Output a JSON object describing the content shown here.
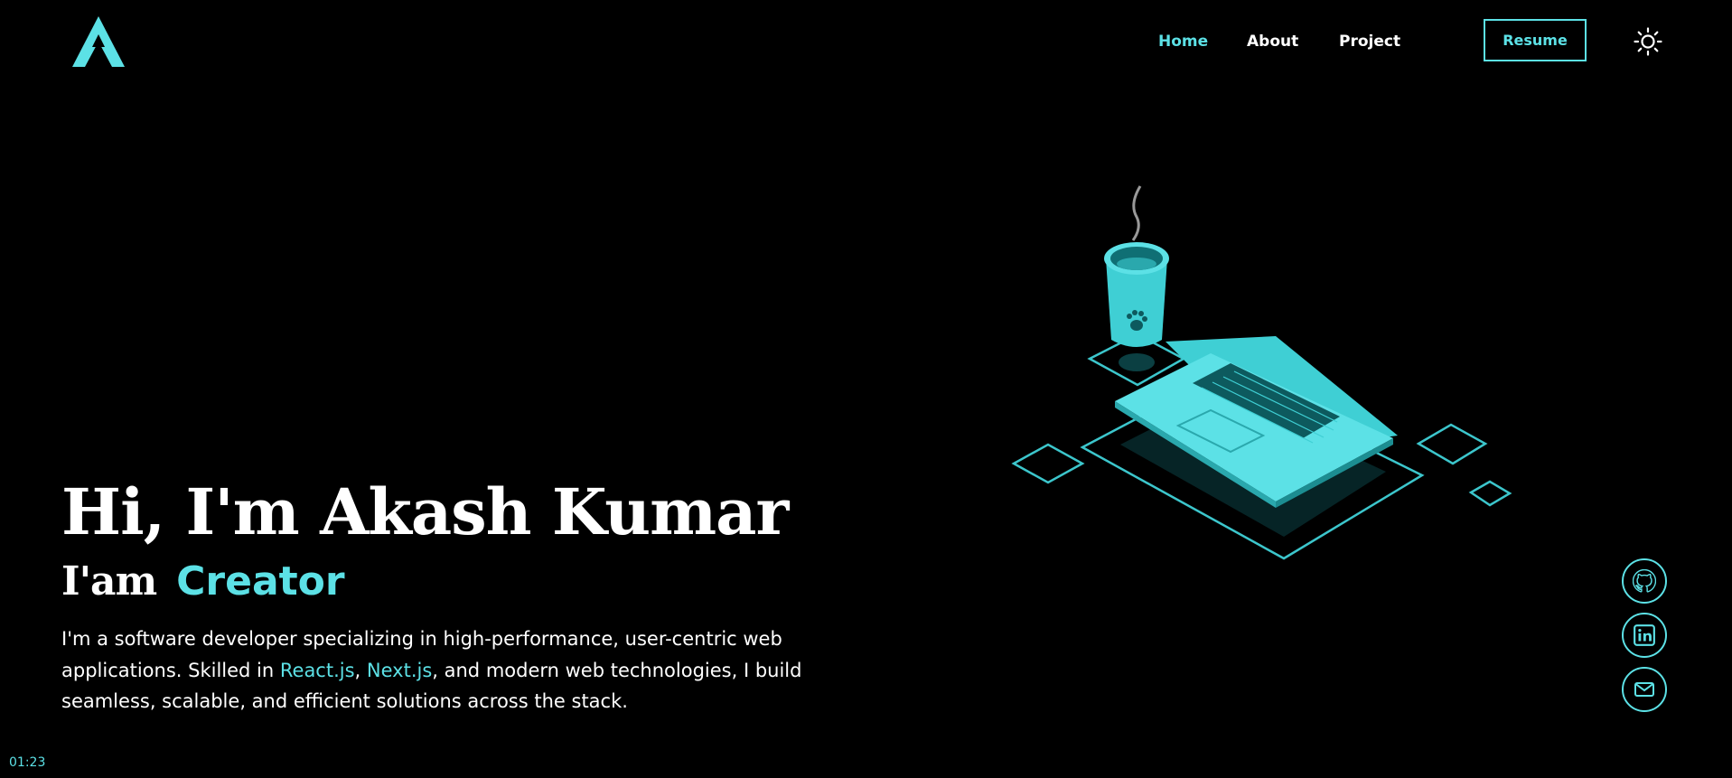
{
  "nav": {
    "home": "Home",
    "about": "About",
    "project": "Project",
    "resume": "Resume"
  },
  "hero": {
    "title": "Hi, I'm Akash Kumar",
    "sub_prefix": "I'am",
    "role": "Creator",
    "desc_1": "I'm a software developer specializing in high-performance, user-centric web applications. Skilled in ",
    "tech_1": "React.js",
    "sep": ", ",
    "tech_2": "Next.js",
    "desc_2": ", and modern web technologies, I build seamless, scalable, and efficient solutions across the stack."
  },
  "clock": "01:23",
  "icons": {
    "logo": "logo-a-icon",
    "theme": "sun-icon",
    "github": "github-icon",
    "linkedin": "linkedin-icon",
    "mail": "mail-icon"
  },
  "colors": {
    "accent": "#5ce1e6",
    "background": "#000000",
    "text": "#ffffff"
  }
}
